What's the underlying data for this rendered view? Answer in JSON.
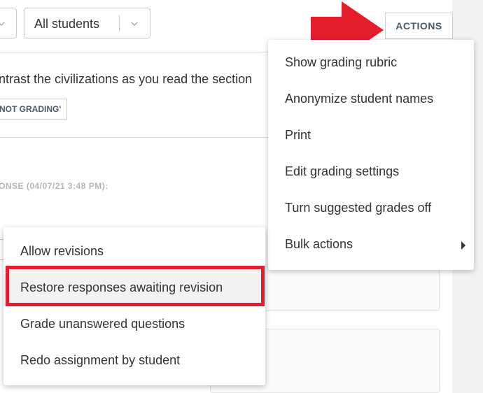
{
  "toolbar": {
    "student_filter_label": "All students",
    "actions_label": "ACTIONS"
  },
  "content": {
    "prompt_text": "ntrast the civilizations as you read the section",
    "tag_label": "NOT GRADING'",
    "response_label": "ONSE (04/07/21 3:48 PM):"
  },
  "actions_menu": {
    "items": [
      {
        "label": "Show grading rubric"
      },
      {
        "label": "Anonymize student names"
      },
      {
        "label": "Print"
      },
      {
        "label": "Edit grading settings"
      },
      {
        "label": "Turn suggested grades off"
      },
      {
        "label": "Bulk actions"
      }
    ]
  },
  "bulk_submenu": {
    "items": [
      {
        "label": "Allow revisions"
      },
      {
        "label": "Restore responses awaiting revision"
      },
      {
        "label": "Grade unanswered questions"
      },
      {
        "label": "Redo assignment by student"
      }
    ],
    "highlighted_index": 1
  },
  "colors": {
    "annotation_red": "#e31d2b",
    "accent_text": "#4a5a6a"
  }
}
